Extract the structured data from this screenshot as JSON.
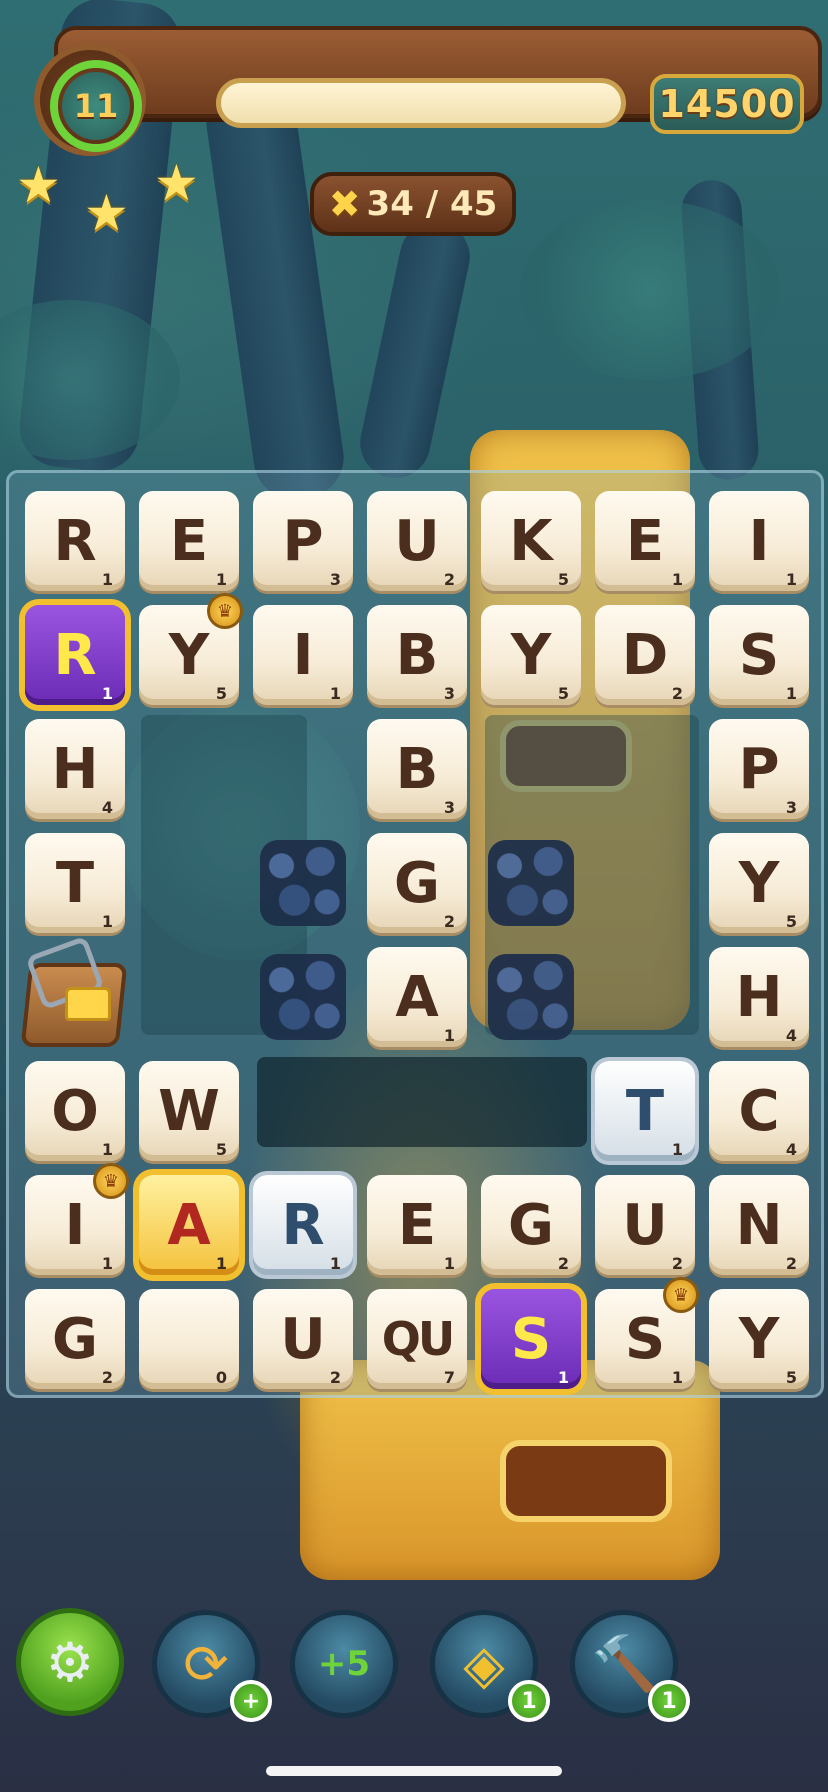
{
  "hud": {
    "level": "11",
    "score": "14500",
    "moves": "34 / 45",
    "stars_earned": 3
  },
  "board": {
    "rows": [
      [
        {
          "letter": "R",
          "points": "1"
        },
        {
          "letter": "E",
          "points": "1"
        },
        {
          "letter": "P",
          "points": "3"
        },
        {
          "letter": "U",
          "points": "2"
        },
        {
          "letter": "K",
          "points": "5"
        },
        {
          "letter": "E",
          "points": "1"
        },
        {
          "letter": "I",
          "points": "1"
        }
      ],
      [
        {
          "letter": "R",
          "points": "1",
          "kind": "purple"
        },
        {
          "letter": "Y",
          "points": "5",
          "crown": true
        },
        {
          "letter": "I",
          "points": "1"
        },
        {
          "letter": "B",
          "points": "3"
        },
        {
          "letter": "Y",
          "points": "5"
        },
        {
          "letter": "D",
          "points": "2"
        },
        {
          "letter": "S",
          "points": "1"
        }
      ],
      [
        {
          "letter": "H",
          "points": "4"
        },
        null,
        null,
        {
          "letter": "B",
          "points": "3"
        },
        null,
        null,
        {
          "letter": "P",
          "points": "3"
        }
      ],
      [
        {
          "letter": "T",
          "points": "1"
        },
        null,
        {
          "kind": "rock"
        },
        {
          "letter": "G",
          "points": "2"
        },
        {
          "kind": "rock"
        },
        null,
        {
          "letter": "Y",
          "points": "5"
        }
      ],
      [
        {
          "kind": "trap"
        },
        null,
        {
          "kind": "rock"
        },
        {
          "letter": "A",
          "points": "1"
        },
        {
          "kind": "rock"
        },
        null,
        {
          "letter": "H",
          "points": "4"
        }
      ],
      [
        {
          "letter": "O",
          "points": "1"
        },
        {
          "letter": "W",
          "points": "5"
        },
        null,
        null,
        null,
        {
          "letter": "T",
          "points": "1",
          "kind": "silver"
        },
        {
          "letter": "C",
          "points": "4"
        }
      ],
      [
        {
          "letter": "I",
          "points": "1",
          "crown": true
        },
        {
          "letter": "A",
          "points": "1",
          "kind": "golden"
        },
        {
          "letter": "R",
          "points": "1",
          "kind": "silver"
        },
        {
          "letter": "E",
          "points": "1"
        },
        {
          "letter": "G",
          "points": "2"
        },
        {
          "letter": "U",
          "points": "2"
        },
        {
          "letter": "N",
          "points": "2"
        }
      ],
      [
        {
          "letter": "G",
          "points": "2"
        },
        {
          "letter": "",
          "points": "0"
        },
        {
          "letter": "U",
          "points": "2"
        },
        {
          "letter": "QU",
          "points": "7"
        },
        {
          "letter": "S",
          "points": "1",
          "kind": "purple"
        },
        {
          "letter": "S",
          "points": "1",
          "crown": true
        },
        {
          "letter": "Y",
          "points": "5"
        }
      ]
    ]
  },
  "toolbar": {
    "settings_icon": "gear-icon",
    "shuffle_icon": "shuffle-arrows-icon",
    "shuffle_add": "+",
    "plus_five_icon": "plus-five-moves-icon",
    "swap_icon": "swap-tile-icon",
    "swap_count": "1",
    "hammer_icon": "hammer-icon",
    "hammer_count": "1"
  },
  "colors": {
    "tile_face": "#f6ebd6",
    "tile_text": "#4b2e1e",
    "gold_border": "#f2c02e",
    "purple_tile": "#7a3bc8",
    "accent_green": "#6fd33a"
  }
}
